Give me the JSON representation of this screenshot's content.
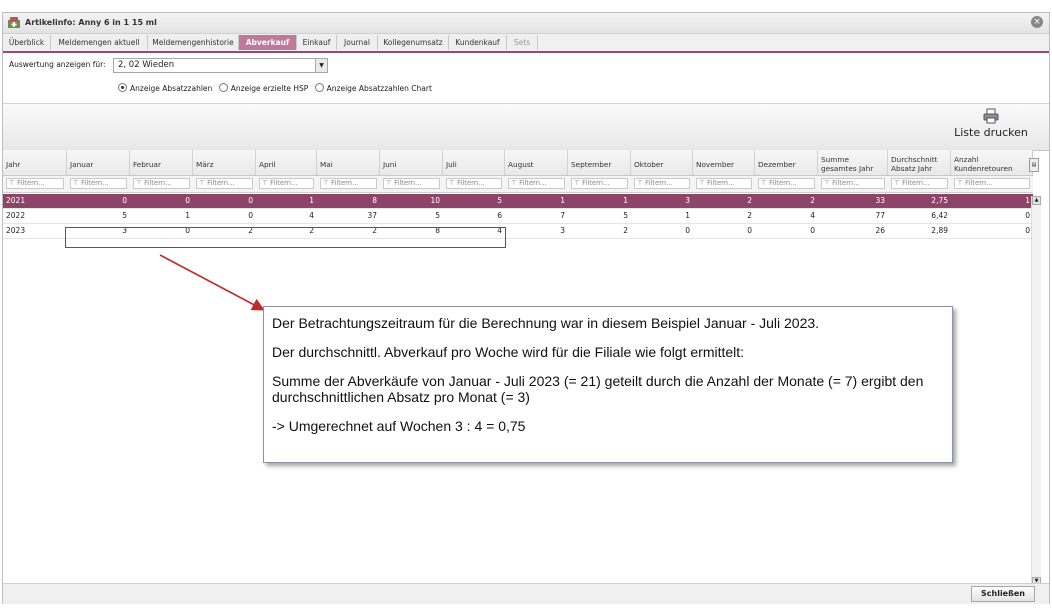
{
  "window": {
    "title": "Artikelinfo: Anny 6 in 1 15 ml",
    "icon": "pharmacy-icon",
    "close_icon": "close-circle-icon"
  },
  "tabs": [
    {
      "label": "Überblick",
      "state": "normal"
    },
    {
      "label": "Meldemengen aktuell",
      "state": "normal"
    },
    {
      "label": "Meldemengenhistorie",
      "state": "normal"
    },
    {
      "label": "Abverkauf",
      "state": "active"
    },
    {
      "label": "Einkauf",
      "state": "normal"
    },
    {
      "label": "Journal",
      "state": "normal"
    },
    {
      "label": "Kollegenumsatz",
      "state": "normal"
    },
    {
      "label": "Kundenkauf",
      "state": "normal"
    },
    {
      "label": "Sets",
      "state": "disabled"
    }
  ],
  "filter": {
    "label": "Auswertung anzeigen für:",
    "value": "2, 02 Wieden",
    "radios": [
      {
        "label": "Anzeige Absatzzahlen",
        "checked": true
      },
      {
        "label": "Anzeige erzielte HSP",
        "checked": false
      },
      {
        "label": "Anzeige Absatzzahlen Chart",
        "checked": false
      }
    ]
  },
  "toolbar": {
    "print_label": "Liste drucken",
    "print_icon": "printer-icon"
  },
  "grid": {
    "columns": [
      "Jahr",
      "Januar",
      "Februar",
      "März",
      "April",
      "Mai",
      "Juni",
      "Juli",
      "August",
      "September",
      "Oktober",
      "November",
      "Dezember",
      "Summe gesamtes Jahr",
      "Durchschnitt Absatz Jahr",
      "Anzahl Kundenretouren"
    ],
    "filter_placeholder": "Filtern...",
    "rows": [
      {
        "selected": true,
        "cells": [
          "2021",
          "0",
          "0",
          "0",
          "1",
          "8",
          "10",
          "5",
          "1",
          "1",
          "3",
          "2",
          "2",
          "33",
          "2,75",
          "1"
        ]
      },
      {
        "selected": false,
        "cells": [
          "2022",
          "5",
          "1",
          "0",
          "4",
          "37",
          "5",
          "6",
          "7",
          "5",
          "1",
          "2",
          "4",
          "77",
          "6,42",
          "0"
        ]
      },
      {
        "selected": false,
        "cells": [
          "2023",
          "3",
          "0",
          "2",
          "2",
          "2",
          "8",
          "4",
          "3",
          "2",
          "0",
          "0",
          "0",
          "26",
          "2,89",
          "0"
        ]
      }
    ]
  },
  "annotation": {
    "line1": "Der Betrachtungszeitraum für die Berechnung war in diesem Beispiel Januar - Juli 2023.",
    "line2": "Der durchschnittl. Abverkauf pro Woche wird für die Filiale wie folgt ermittelt:",
    "line3": "Summe der Abverkäufe von Januar - Juli 2023 (= 21) geteilt durch die Anzahl der Monate (= 7) ergibt den durchschnittlichen Absatz pro Monat (= 3)",
    "line4": "-> Umgerechnet auf Wochen 3 : 4 = 0,75",
    "highlight_color": "#c02b2b"
  },
  "footer": {
    "close_label": "Schließen"
  },
  "colors": {
    "accent": "#9b4a6f",
    "active_tab": "#c07a99",
    "selected_row": "#8e4468"
  }
}
